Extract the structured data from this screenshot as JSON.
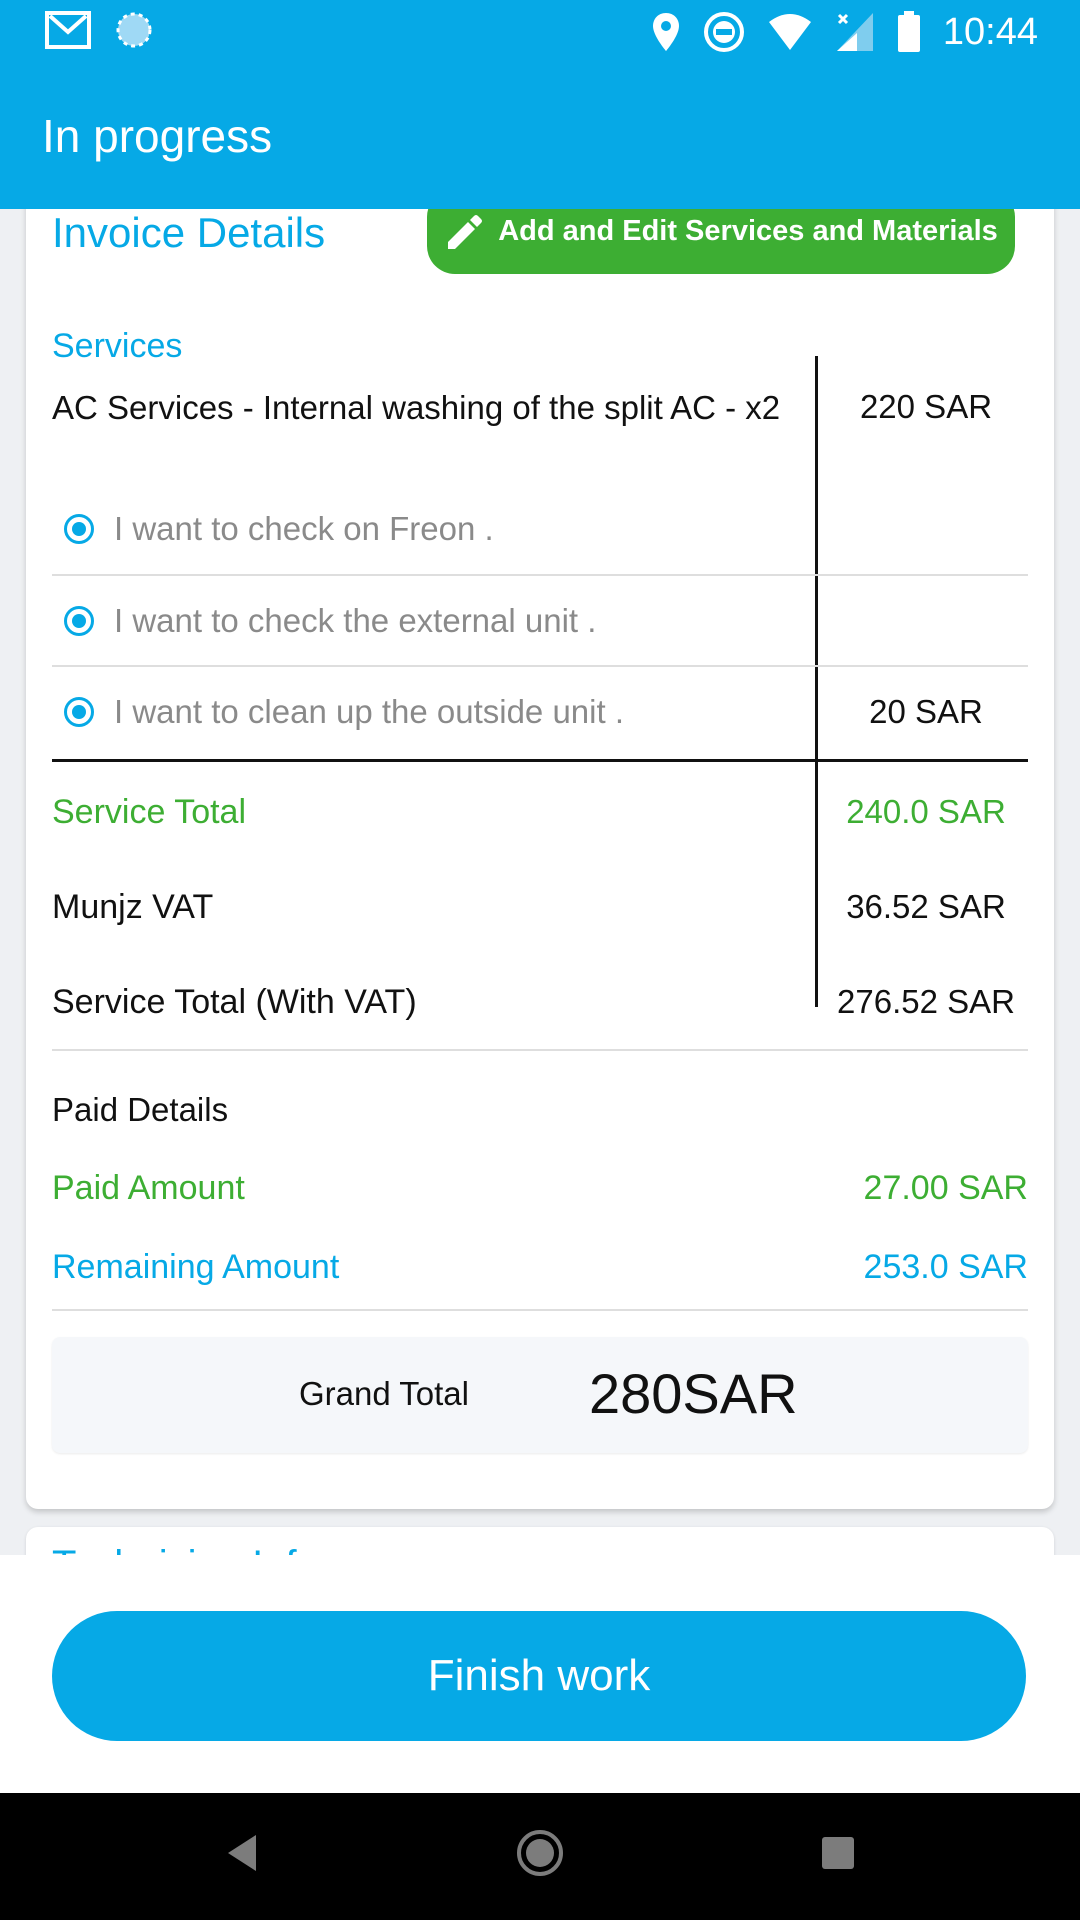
{
  "status_bar": {
    "time": "10:44"
  },
  "app_bar": {
    "title": "In progress"
  },
  "invoice": {
    "title": "Invoice Details",
    "edit_button_label": "Add and Edit Services and Materials",
    "services_label": "Services",
    "service": {
      "name": "AC Services - Internal washing of the split AC - x2",
      "price": "220 SAR",
      "options": [
        {
          "text": "I want to check on Freon .",
          "price": ""
        },
        {
          "text": "I want to check the external unit .",
          "price": ""
        },
        {
          "text": "I want to clean up the outside unit .",
          "price": "20 SAR"
        }
      ]
    },
    "totals": [
      {
        "label": "Service Total",
        "value": "240.0 SAR"
      },
      {
        "label": "Munjz VAT",
        "value": "36.52 SAR"
      },
      {
        "label": "Service Total (With VAT)",
        "value": "276.52 SAR"
      }
    ],
    "paid_details": {
      "title": "Paid Details",
      "paid_label": "Paid Amount",
      "paid_value": "27.00 SAR",
      "remaining_label": "Remaining Amount",
      "remaining_value": "253.0 SAR"
    },
    "grand_total": {
      "label": "Grand Total",
      "value": "280SAR"
    }
  },
  "next_card_title": "Technician Info",
  "finish_button_label": "Finish work",
  "colors": {
    "primary": "#06a9e6",
    "green": "#3dae33",
    "nav": "#000000"
  },
  "icons": [
    "gmail-icon",
    "sync-icon",
    "location-icon",
    "dnd-icon",
    "wifi-icon",
    "signal-icon",
    "battery-icon",
    "pencil-icon",
    "back-icon",
    "home-icon",
    "recents-icon"
  ]
}
